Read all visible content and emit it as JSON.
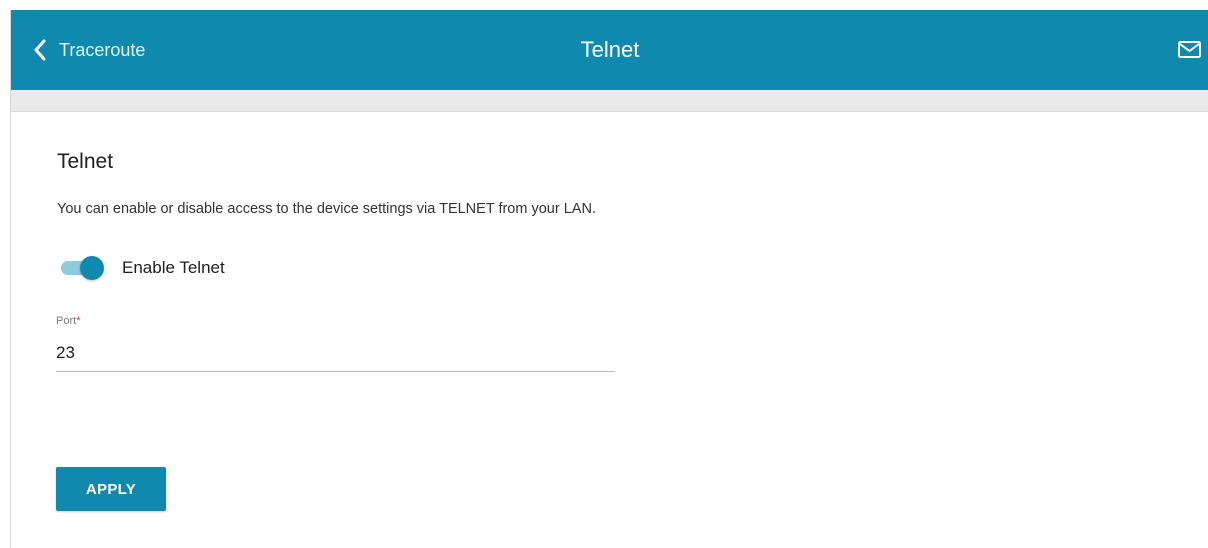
{
  "header": {
    "back_label": "Traceroute",
    "title": "Telnet",
    "back_icon": "chevron-left-icon",
    "mail_icon": "envelope-icon"
  },
  "section": {
    "title": "Telnet",
    "description": "You can enable or disable access to the device settings via TELNET from your LAN."
  },
  "toggle": {
    "label": "Enable Telnet",
    "enabled": true
  },
  "port": {
    "label": "Port",
    "required_mark": "*",
    "value": "23"
  },
  "apply_label": "APPLY",
  "colors": {
    "accent": "#0f8aae",
    "toggle_track": "#8ecbdb",
    "required": "#e23a3a"
  }
}
